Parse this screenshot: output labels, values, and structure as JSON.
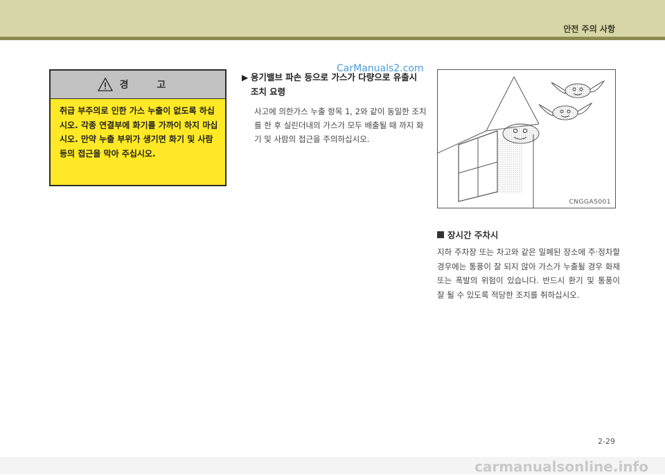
{
  "header": {
    "section_title": "안전 주의 사항"
  },
  "warning": {
    "title": "경   고",
    "text": "취급 부주의로 인한 가스 누출이 없도록 하십시오. 각종 연결부에 화기를 가까이 하지 마십시오. 만약 누출 부위가 생기면 화기 및 사람등의 접근을 막아 주십시오."
  },
  "bullet": {
    "heading": "용기밸브 파손 등으로 가스가 다량으로 유출시 조치 요령",
    "body": "사고에 의한가스 누출 항목 1, 2와 같이 동일한 조치를 한 후 실린더내의 가스가 모두 배출될 때 까지 화기 및 사람의 접근을 주의하십시오."
  },
  "watermark_top": "CarManuals2.com",
  "figure": {
    "code": "CNGGAS001"
  },
  "parking": {
    "heading": "장시간 주차시",
    "body": "지하 주차장 또는 차고와 같은 밀폐된 장소에 주·정차할 경우에는 통풍이 잘 되지 않아 가스가 누출될 경우 화재 또는 폭발의 위험이 있습니다. 반드시 환기 및 통풍이 잘 될 수 있도록 적당한 조치를 취하십시오."
  },
  "page_number": "2-29",
  "footer_watermark": "carmanualsonline.info"
}
